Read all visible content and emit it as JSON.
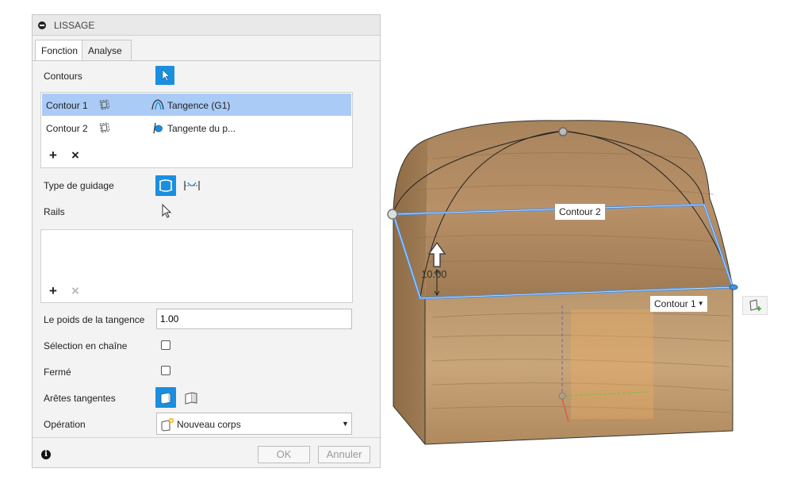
{
  "dialog": {
    "title": "LISSAGE",
    "tabs": [
      {
        "label": "Fonction"
      },
      {
        "label": "Analyse"
      }
    ],
    "contours_label": "Contours",
    "profiles": [
      {
        "name": "Contour 1",
        "condition": "Tangence (G1)"
      },
      {
        "name": "Contour 2",
        "condition": "Tangente du p..."
      }
    ],
    "guide_type_label": "Type de guidage",
    "rails_label": "Rails",
    "tangent_weight_label": "Le poids de la tangence",
    "tangent_weight_value": "1.00",
    "chain_selection_label": "Sélection en chaîne",
    "closed_label": "Fermé",
    "tangent_edges_label": "Arêtes tangentes",
    "operation_label": "Opération",
    "operation_value": "Nouveau corps",
    "ok_label": "OK",
    "cancel_label": "Annuler"
  },
  "viewport": {
    "contour2_label": "Contour 2",
    "contour1_label": "Contour 1",
    "dimension_value": "10.00"
  },
  "colors": {
    "accent": "#1a8fdf",
    "selection_row": "#aacbf5",
    "profile_line": "#4a90e2",
    "wood": "#b08a5e"
  }
}
